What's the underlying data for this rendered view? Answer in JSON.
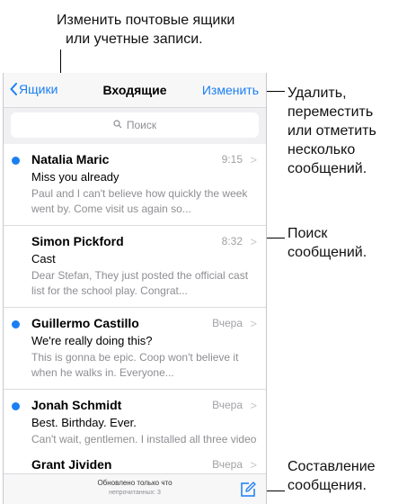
{
  "callouts": {
    "top": [
      "Изменить почтовые ящики",
      "или учетные записи."
    ],
    "edit": [
      "Удалить,",
      "переместить",
      "или отметить",
      "несколько",
      "сообщений."
    ],
    "search": [
      "Поиск",
      "сообщений."
    ],
    "compose": [
      "Составление",
      "сообщения."
    ]
  },
  "navbar": {
    "back_label": "Ящики",
    "title": "Входящие",
    "edit_label": "Изменить"
  },
  "search": {
    "placeholder": "Поиск"
  },
  "messages": [
    {
      "unread": true,
      "sender": "Natalia Maric",
      "time": "9:15",
      "subject": "Miss you already",
      "preview": "Paul and I can't believe how quickly the week went by. Come visit us again so..."
    },
    {
      "unread": false,
      "sender": "Simon Pickford",
      "time": "8:32",
      "subject": "Cast",
      "preview": "Dear Stefan, They just posted the official cast list for the school play. Congrat..."
    },
    {
      "unread": true,
      "sender": "Guillermo Castillo",
      "time": "Вчера",
      "subject": "We're really doing this?",
      "preview": "This is gonna be epic. Coop won't believe it when he walks in. Everyone..."
    },
    {
      "unread": true,
      "sender": "Jonah Schmidt",
      "time": "Вчера",
      "subject": "Best. Birthday. Ever.",
      "preview": "Can't wait, gentlemen. I installed all three video cameras last night and..."
    },
    {
      "unread": false,
      "sender": "Grant Jividen",
      "time": "Вчера",
      "subject": "",
      "preview": ""
    }
  ],
  "toolbar": {
    "status_line1": "Обновлено только что",
    "status_line2": "непрочитанных: 3"
  },
  "colors": {
    "accent": "#1a7ff2",
    "unread_dot": "#1a7ff2",
    "muted": "#8e8e93"
  },
  "icons": {
    "back": "chevron-left-icon",
    "search": "magnifier-icon",
    "compose": "compose-icon",
    "row": "chevron-right-icon"
  }
}
